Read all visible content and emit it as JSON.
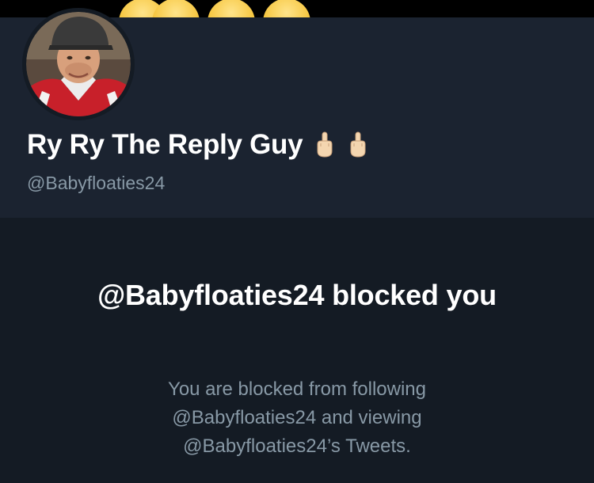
{
  "profile": {
    "display_name": "Ry Ry The Reply Guy",
    "name_emojis": [
      "middle-finger-emoji-icon",
      "middle-finger-emoji-icon"
    ],
    "handle": "@Babyfloaties24",
    "avatar_icon": "profile-photo-avatar"
  },
  "banner": {
    "decoration": "yellow-emoji-faces",
    "colors": {
      "emoji_yellow": "#f6c640"
    }
  },
  "blocked_notice": {
    "title": "@Babyfloaties24 blocked you",
    "description": "You are blocked from following @Babyfloaties24 and viewing @Babyfloaties24’s Tweets."
  },
  "theme": {
    "background": "#141b24",
    "header_background": "#1b2330",
    "primary_text": "#ffffff",
    "secondary_text": "#8899a6"
  }
}
